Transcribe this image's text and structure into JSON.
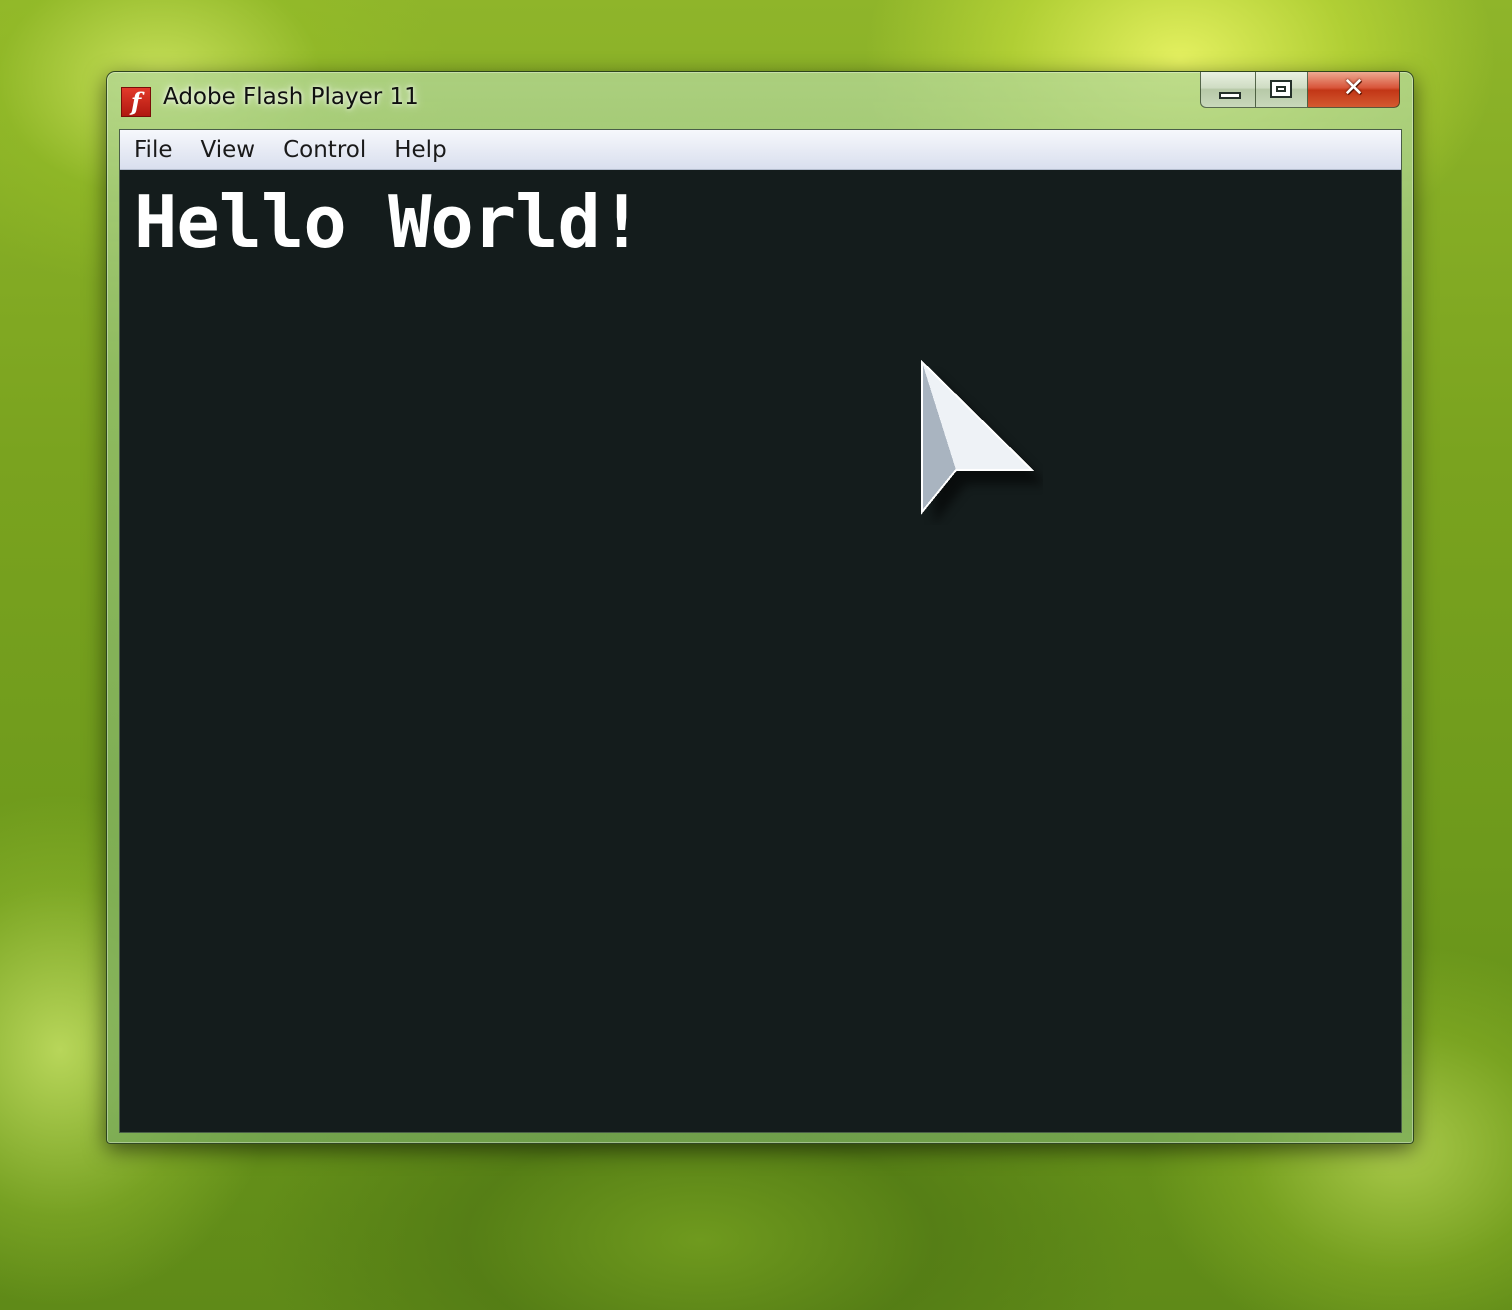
{
  "window": {
    "title": "Adobe Flash Player 11",
    "icon": "flash-player-icon",
    "icon_glyph": "f",
    "controls": {
      "minimize_icon": "minimize-icon",
      "maximize_icon": "maximize-icon",
      "close_icon": "close-icon",
      "close_glyph": "✕"
    }
  },
  "menubar": {
    "items": [
      {
        "label": "File"
      },
      {
        "label": "View"
      },
      {
        "label": "Control"
      },
      {
        "label": "Help"
      }
    ]
  },
  "stage": {
    "text": "Hello World!",
    "background_color": "#141c1c",
    "text_color": "#ffffff",
    "cursor_icon": "arrow-cursor-icon"
  },
  "colors": {
    "close_button": "#c23616",
    "menubar": "#e6eaf4",
    "desktop": "#7aa31f"
  }
}
